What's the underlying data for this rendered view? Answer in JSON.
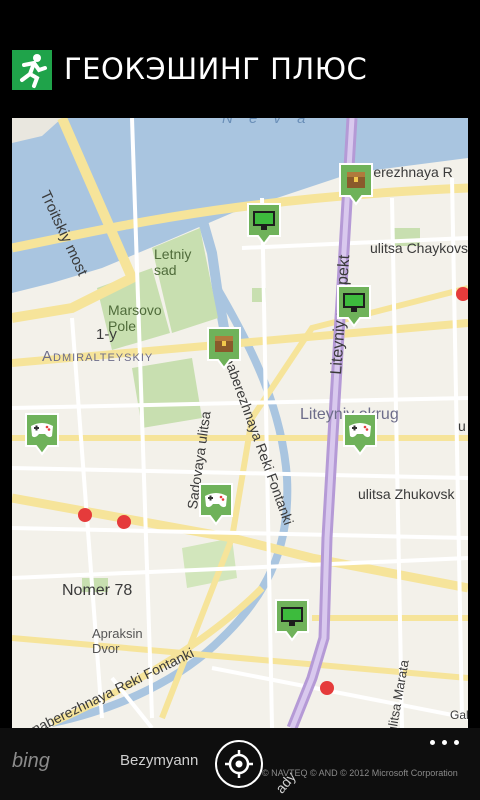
{
  "app": {
    "title": "ГЕОКЭШИНГ ПЛЮС",
    "logo_icon": "running-man-icon",
    "logo_color": "#1fa34a"
  },
  "map": {
    "river_label": "N e v a",
    "labels": {
      "troitskiy_most": "Troitskiy most",
      "letniy_sad": "Letniy\nsad",
      "marsovo_pole": "Marsovo\nPole",
      "admiralteyskiy": "Admiralteyskiy",
      "one_y": "1-y",
      "liteyniy_prospekt": "Liteyniy prospekt",
      "naberezhnaya_top": "naberezhnaya R",
      "ulitsa_chaykovs": "ulitsa Chaykovs",
      "liteyniy_okrug": "Liteyniy okrug",
      "sadovaya": "Sadovaya ulitsa",
      "reki_fontanki_vertical": "naberezhnaya Reki Fontanki",
      "ulitsa_zhukovsk": "ulitsa Zhukovsk",
      "u": "u",
      "nomer78": "Nomer 78",
      "apraksin": "Apraksin\nDvor",
      "reki_fontanki_bottom": "nnaberezhnaya Reki Fontanki",
      "ulitsa_marata": "ulitsa Marata",
      "zagorodny": "ady",
      "bezymyann": "Bezymyann",
      "gal": "Gal"
    },
    "metro_symbol": "M",
    "markers": [
      {
        "type": "treasure-chest",
        "color": "#6fb25a"
      },
      {
        "type": "monitor",
        "color": "#6fb25a"
      },
      {
        "type": "monitor",
        "color": "#6fb25a"
      },
      {
        "type": "treasure-chest",
        "color": "#6fb25a"
      },
      {
        "type": "gamepad",
        "color": "#6fb25a"
      },
      {
        "type": "gamepad",
        "color": "#6fb25a"
      },
      {
        "type": "gamepad",
        "color": "#6fb25a"
      },
      {
        "type": "monitor",
        "color": "#6fb25a"
      }
    ],
    "attribution": "© NAVTEQ  © AND  © 2012 Microsoft Corporation",
    "bing_logo": "bing"
  },
  "appbar": {
    "locate_icon": "location-target-icon",
    "more_icon": "more-dots-icon"
  }
}
